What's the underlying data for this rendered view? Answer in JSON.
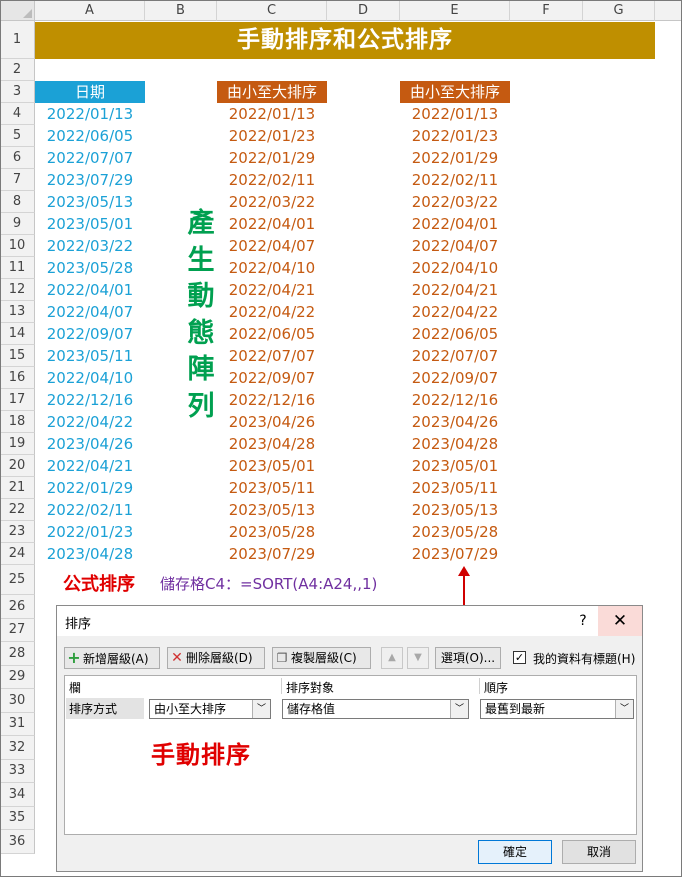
{
  "columns": [
    "A",
    "B",
    "C",
    "D",
    "E",
    "F",
    "G"
  ],
  "rows": [
    "1",
    "2",
    "3",
    "4",
    "5",
    "6",
    "7",
    "8",
    "9",
    "10",
    "11",
    "12",
    "13",
    "14",
    "15",
    "16",
    "17",
    "18",
    "19",
    "20",
    "21",
    "22",
    "23",
    "24",
    "25",
    "26",
    "27",
    "28",
    "29",
    "30",
    "31",
    "32",
    "33",
    "34",
    "35",
    "36"
  ],
  "title": "手動排序和公式排序",
  "headers": {
    "a": "日期",
    "c": "由小至大排序",
    "e": "由小至大排序"
  },
  "col_a": [
    "2022/01/13",
    "2022/06/05",
    "2022/07/07",
    "2023/07/29",
    "2023/05/13",
    "2023/05/01",
    "2022/03/22",
    "2023/05/28",
    "2022/04/01",
    "2022/04/07",
    "2022/09/07",
    "2023/05/11",
    "2022/04/10",
    "2022/12/16",
    "2022/04/22",
    "2023/04/26",
    "2022/04/21",
    "2022/01/29",
    "2022/02/11",
    "2022/01/23",
    "2023/04/28"
  ],
  "col_c": [
    "2022/01/13",
    "2022/01/23",
    "2022/01/29",
    "2022/02/11",
    "2022/03/22",
    "2022/04/01",
    "2022/04/07",
    "2022/04/10",
    "2022/04/21",
    "2022/04/22",
    "2022/06/05",
    "2022/07/07",
    "2022/09/07",
    "2022/12/16",
    "2023/04/26",
    "2023/04/28",
    "2023/05/01",
    "2023/05/11",
    "2023/05/13",
    "2023/05/28",
    "2023/07/29"
  ],
  "col_e": [
    "2022/01/13",
    "2022/01/23",
    "2022/01/29",
    "2022/02/11",
    "2022/03/22",
    "2022/04/01",
    "2022/04/07",
    "2022/04/10",
    "2022/04/21",
    "2022/04/22",
    "2022/06/05",
    "2022/07/07",
    "2022/09/07",
    "2022/12/16",
    "2023/04/26",
    "2023/04/28",
    "2023/05/01",
    "2023/05/11",
    "2023/05/13",
    "2023/05/28",
    "2023/07/29"
  ],
  "vertical_label": [
    "產",
    "生",
    "動",
    "態",
    "陣",
    "列"
  ],
  "formula_label": "公式排序",
  "formula_text": "儲存格C4：=SORT(A4:A24,,1)",
  "colors": {
    "title_bg": "#bf8f00",
    "blue": "#1ba1d6",
    "orange": "#c55a11",
    "green": "#00a050",
    "red": "#e00000",
    "purple": "#7030a0"
  },
  "dialog": {
    "title": "排序",
    "help": "?",
    "close": "✕",
    "add_level": "新增層級(A)",
    "delete_level": "刪除層級(D)",
    "copy_level": "複製層級(C)",
    "options": "選項(O)...",
    "has_headers_label": "我的資料有標題(H)",
    "has_headers_checked": true,
    "col_header": "欄",
    "sort_on_header": "排序對象",
    "order_header": "順序",
    "row_label": "排序方式",
    "sort_by_value": "由小至大排序",
    "sort_on_value": "儲存格值",
    "order_value": "最舊到最新",
    "overlay": "手動排序",
    "ok": "確定",
    "cancel": "取消",
    "icons": [
      "plus-icon",
      "delete-x-icon",
      "copy-icon",
      "up-arrow-icon",
      "down-arrow-icon",
      "dropdown-arrow-icon"
    ]
  }
}
